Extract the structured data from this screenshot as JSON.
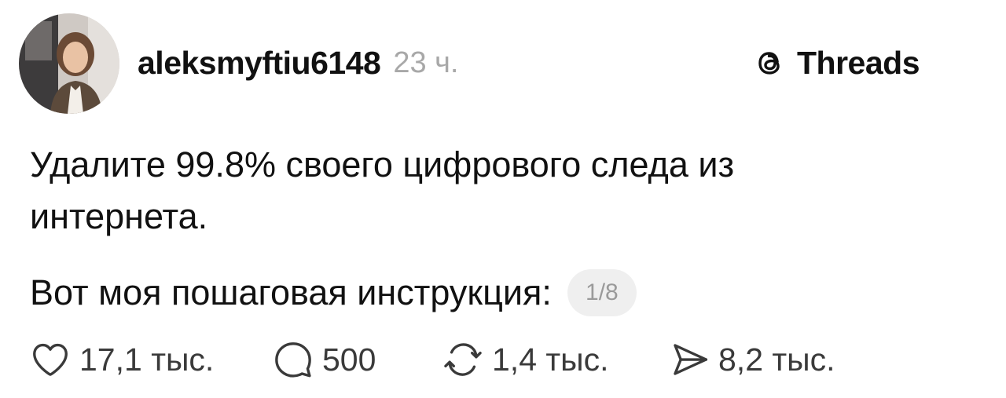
{
  "post": {
    "username": "aleksmyftiu6148",
    "timestamp": "23 ч.",
    "text_line1": "Удалите 99.8% своего цифрового следа из",
    "text_line2": "интернета.",
    "instruction": "Вот моя пошаговая инструкция:",
    "page_badge": "1/8"
  },
  "brand": {
    "name": "Threads",
    "icon": "threads-logo-icon"
  },
  "actions": {
    "like": {
      "icon": "heart-icon",
      "count": "17,1 тыс."
    },
    "comment": {
      "icon": "comment-icon",
      "count": "500"
    },
    "repost": {
      "icon": "repost-icon",
      "count": "1,4 тыс."
    },
    "share": {
      "icon": "share-icon",
      "count": "8,2 тыс."
    }
  },
  "colors": {
    "text": "#111111",
    "muted": "#a8a8a8",
    "badge_bg": "#efefef"
  }
}
